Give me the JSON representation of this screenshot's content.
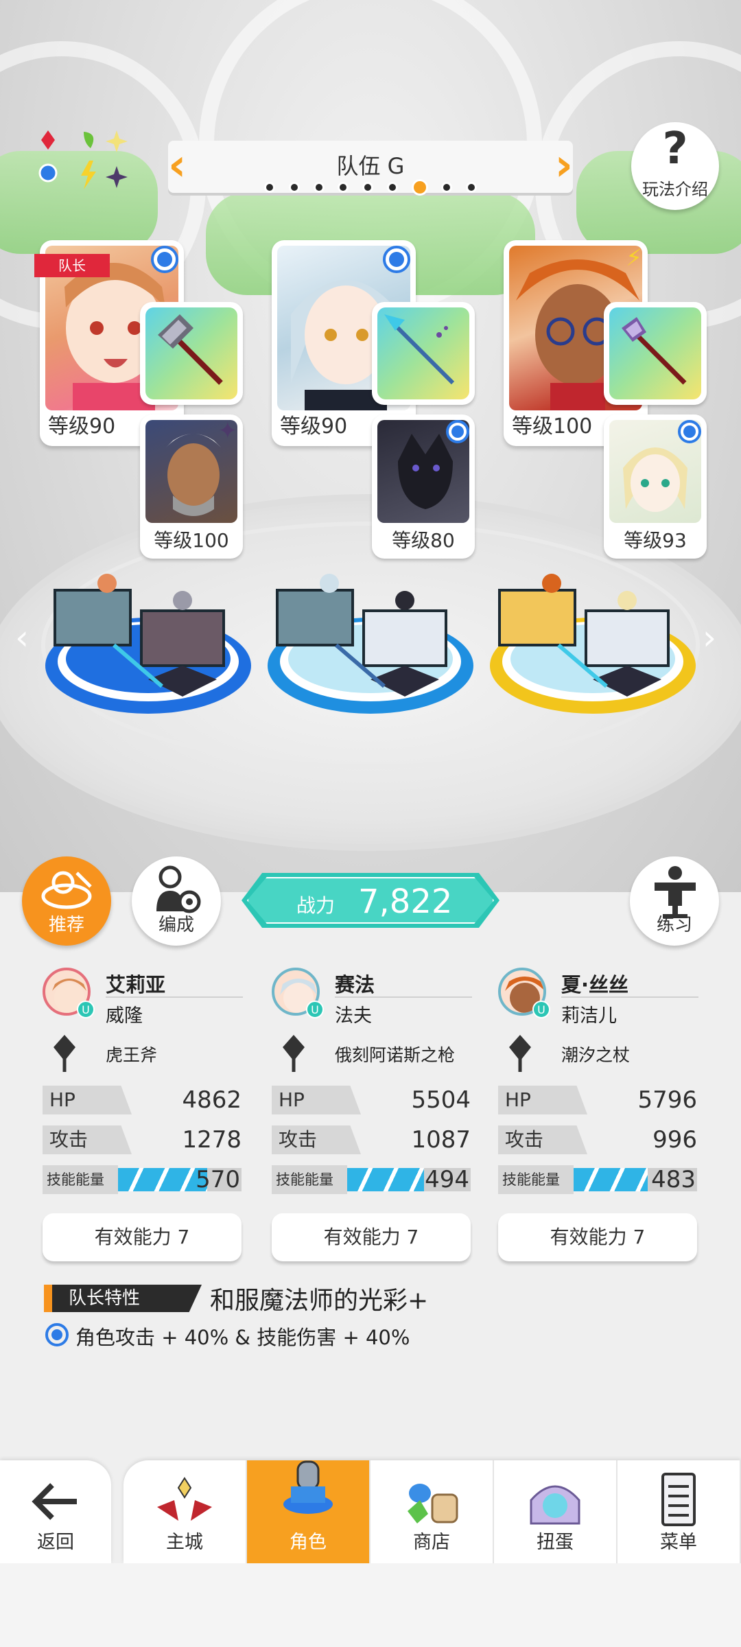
{
  "team": {
    "title": "队伍 G",
    "dots_total": 9,
    "dot_active_index": 6
  },
  "help": {
    "label": "玩法介绍"
  },
  "leader_tag": "队长",
  "slots": [
    {
      "level": "等级90",
      "badge": "circle-blue",
      "sub_level": "等级100",
      "sub_badge": "star-dark",
      "pedestal": "blue"
    },
    {
      "level": "等级90",
      "badge": "circle-blue",
      "sub_level": "等级80",
      "sub_badge": "circle-blue",
      "pedestal": "blue"
    },
    {
      "level": "等级100",
      "badge": "bolt-yellow",
      "sub_level": "等级93",
      "sub_badge": "circle-blue",
      "pedestal": "yellow"
    }
  ],
  "controls": {
    "recommend_label": "推荐",
    "formation_label": "编成",
    "power_label": "战力",
    "power_value": "7,822",
    "practice_label": "练习"
  },
  "stats": [
    {
      "name": "艾莉亚",
      "sub": "威隆",
      "weapon": "虎王斧",
      "hp_label": "HP",
      "hp": "4862",
      "atk_label": "攻击",
      "atk": "1278",
      "skill_label": "技能能量",
      "skill": "570",
      "skill_fill": 0.72,
      "ability": "有效能力 7"
    },
    {
      "name": "赛法",
      "sub": "法夫",
      "weapon": "俄刻阿诺斯之枪",
      "hp_label": "HP",
      "hp": "5504",
      "atk_label": "攻击",
      "atk": "1087",
      "skill_label": "技能能量",
      "skill": "494",
      "skill_fill": 0.62,
      "ability": "有效能力 7"
    },
    {
      "name": "夏·丝丝",
      "sub": "莉洁儿",
      "weapon": "潮汐之杖",
      "hp_label": "HP",
      "hp": "5796",
      "atk_label": "攻击",
      "atk": "996",
      "skill_label": "技能能量",
      "skill": "483",
      "skill_fill": 0.6,
      "ability": "有效能力 7"
    }
  ],
  "leader_trait": {
    "tag": "队长特性",
    "name": "和服魔法师的光彩+",
    "desc": "角色攻击 + 40% & 技能伤害 + 40%"
  },
  "nav": {
    "back": "返回",
    "items": [
      "主城",
      "角色",
      "商店",
      "扭蛋",
      "菜单"
    ],
    "active": "角色"
  },
  "colors": {
    "accent": "#f7a020",
    "teal": "#2cc6b5",
    "blue": "#2d7be6"
  }
}
